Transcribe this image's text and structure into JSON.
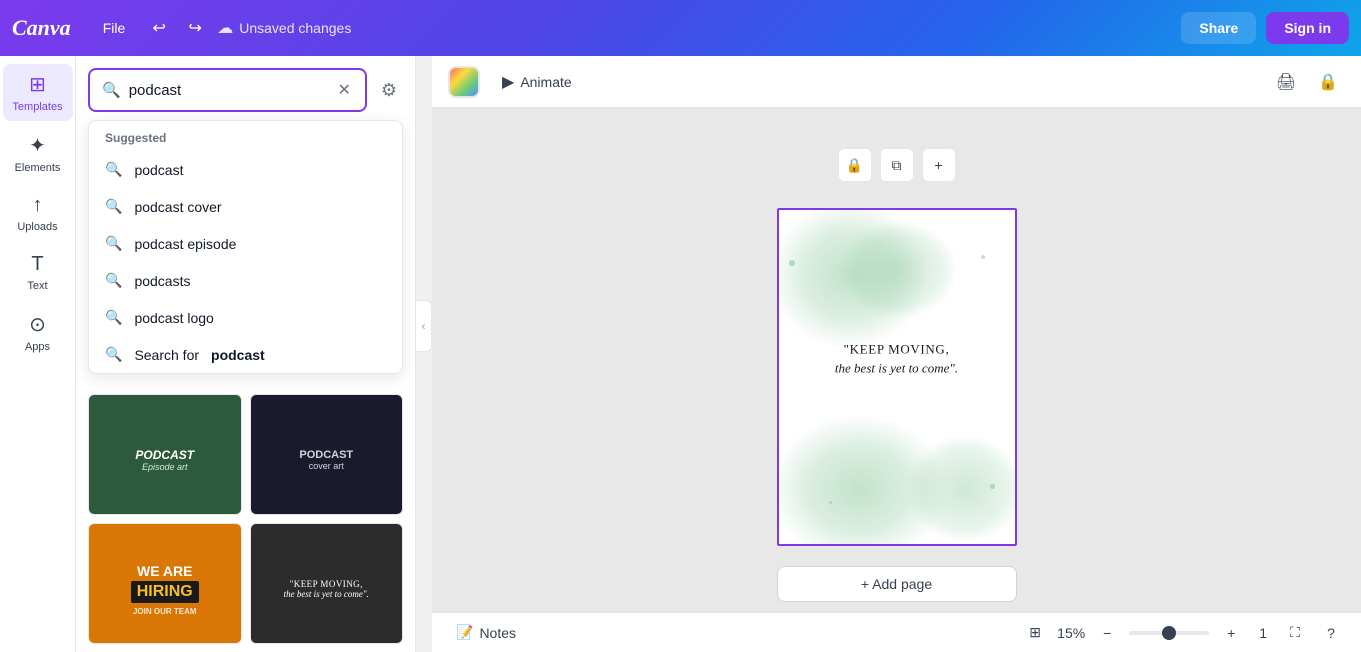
{
  "app": {
    "logo": "Canva",
    "file_label": "File",
    "unsaved_changes": "Unsaved changes",
    "share_label": "Share",
    "signin_label": "Sign in"
  },
  "toolbar": {
    "animate_label": "Animate"
  },
  "sidebar": {
    "items": [
      {
        "id": "templates",
        "label": "Templates",
        "icon": "⊞"
      },
      {
        "id": "elements",
        "label": "Elements",
        "icon": "✦"
      },
      {
        "id": "uploads",
        "label": "Uploads",
        "icon": "↑"
      },
      {
        "id": "text",
        "label": "Text",
        "icon": "T"
      },
      {
        "id": "apps",
        "label": "Apps",
        "icon": "⊙"
      }
    ]
  },
  "search": {
    "placeholder": "Search for podcast",
    "current_value": "podcast",
    "filter_icon": "filter-icon",
    "clear_icon": "clear-icon"
  },
  "suggestions": {
    "section_label": "Suggested",
    "items": [
      {
        "id": "podcast",
        "text": "podcast"
      },
      {
        "id": "podcast-cover",
        "text": "podcast cover"
      },
      {
        "id": "podcast-episode",
        "text": "podcast episode"
      },
      {
        "id": "podcasts",
        "text": "podcasts"
      },
      {
        "id": "podcast-logo",
        "text": "podcast logo"
      },
      {
        "id": "search-for-podcast",
        "text_prefix": "Search for ",
        "text_bold": "podcast"
      }
    ]
  },
  "canvas": {
    "design_quote_main": "\"KEEP MOVING,",
    "design_quote_sub": "the best is yet to come\".",
    "add_page_label": "+ Add page"
  },
  "bottom_bar": {
    "notes_label": "Notes",
    "zoom_level": "15%",
    "page_count": "1",
    "help_icon": "help-icon",
    "fullscreen_icon": "fullscreen-icon"
  },
  "icons": {
    "undo": "↩",
    "redo": "↪",
    "cloud": "☁",
    "search": "🔍",
    "filter": "⚙",
    "close": "✕",
    "lock": "🔒",
    "copy": "⧉",
    "plus": "+",
    "chevron_left": "‹",
    "notes": "📝",
    "zoom_out": "−",
    "zoom_in": "+",
    "page_grid": "⊞",
    "fullscreen": "⛶",
    "help": "?",
    "print": "🖨",
    "key": "⌨"
  }
}
